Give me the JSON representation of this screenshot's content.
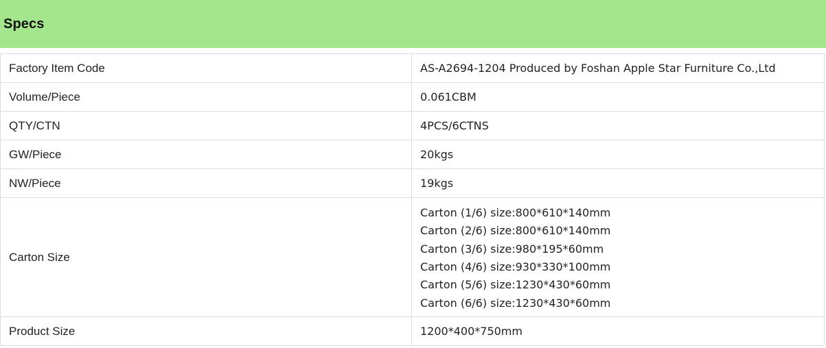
{
  "header": {
    "title": "Specs",
    "background": "#a3e68b"
  },
  "specs": {
    "rows": [
      {
        "label": "Factory Item Code",
        "value": "AS-A2694-1204 Produced by Foshan Apple Star Furniture Co.,Ltd"
      },
      {
        "label": "Volume/Piece",
        "value": "0.061CBM"
      },
      {
        "label": "QTY/CTN",
        "value": "4PCS/6CTNS"
      },
      {
        "label": "GW/Piece",
        "value": "20kgs"
      },
      {
        "label": "NW/Piece",
        "value": "19kgs"
      },
      {
        "label": "Carton Size",
        "lines": [
          "Carton (1/6) size:800*610*140mm",
          "Carton (2/6) size:800*610*140mm",
          "Carton (3/6) size:980*195*60mm",
          "Carton (4/6) size:930*330*100mm",
          "Carton (5/6) size:1230*430*60mm",
          "Carton (6/6) size:1230*430*60mm"
        ]
      },
      {
        "label": "Product Size",
        "value": "1200*400*750mm"
      }
    ]
  }
}
